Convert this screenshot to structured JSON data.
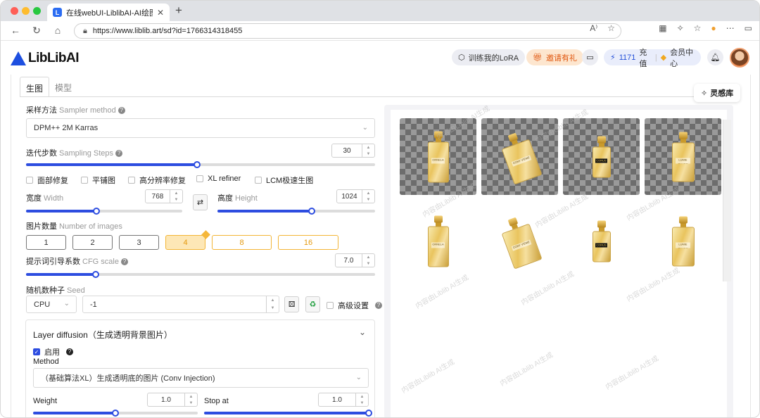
{
  "browser": {
    "tab_title": "在线webUI-LiblibAI-AI绘图工具",
    "tab_favicon": "L",
    "close": "✕",
    "new_tab": "+",
    "url": "https://www.liblib.art/sd?id=1766314318455",
    "nav": {
      "back": "←",
      "reload": "↻",
      "home": "⌂"
    },
    "right_icons": [
      "A⁾",
      "☆",
      "▦",
      "✧",
      "☆",
      "●",
      "⋯",
      "▭"
    ]
  },
  "header": {
    "logo_text": "LibLibAI",
    "train_lora": "训练我的LoRA",
    "invite": "邀请有礼",
    "recharge_count": "1171",
    "recharge_label": "充值",
    "vip": "会员中心"
  },
  "tabs": [
    {
      "label": "生图"
    },
    {
      "label": "模型"
    }
  ],
  "inspiration": "灵感库",
  "sampler": {
    "label": "采样方法",
    "label_en": "Sampler method",
    "value": "DPM++ 2M Karras"
  },
  "steps": {
    "label": "迭代步数",
    "label_en": "Sampling Steps",
    "value": "30",
    "fraction": 0.49
  },
  "options": [
    {
      "label": "面部修复",
      "checked": false
    },
    {
      "label": "平铺图",
      "checked": false
    },
    {
      "label": "高分辨率修复",
      "checked": false
    },
    {
      "label": "XL refiner",
      "checked": false
    },
    {
      "label": "LCM极速生图",
      "checked": false
    }
  ],
  "width": {
    "label": "宽度",
    "label_en": "Width",
    "value": "768",
    "fraction": 0.45
  },
  "height": {
    "label": "高度",
    "label_en": "Height",
    "value": "1024",
    "fraction": 0.6
  },
  "swap_icon": "⇄",
  "image_count": {
    "label": "图片数量",
    "label_en": "Number of images",
    "options": [
      "1",
      "2",
      "3",
      "4",
      "8",
      "16"
    ],
    "selected": "4"
  },
  "cfg": {
    "label": "提示词引导系数",
    "label_en": "CFG scale",
    "value": "7.0",
    "fraction": 0.2
  },
  "seed": {
    "label": "随机数种子",
    "label_en": "Seed",
    "device": "CPU",
    "value": "-1",
    "advanced": "高级设置"
  },
  "layer_diffusion": {
    "title": "Layer diffusion（生成透明背景图片）",
    "enable_label": "启用",
    "enabled": true,
    "method_label": "Method",
    "method_value": "（基础算法XL）生成透明底的图片 (Conv Injection)",
    "weight_label": "Weight",
    "weight_value": "1.0",
    "weight_fraction": 0.5,
    "stop_label": "Stop at",
    "stop_value": "1.0",
    "stop_fraction": 1.0
  },
  "gallery": {
    "images": [
      {
        "label": "ORNELA",
        "bg": "checker"
      },
      {
        "label": "CONY VIEME",
        "bg": "checker"
      },
      {
        "label": "CORUS",
        "bg": "checker"
      },
      {
        "label": "LUMIE GAUDE",
        "bg": "checker"
      },
      {
        "label": "ORNELA",
        "bg": "white"
      },
      {
        "label": "CONY VIEME",
        "bg": "white"
      },
      {
        "label": "CORUS",
        "bg": "white"
      },
      {
        "label": "LUMIE GAUDE",
        "bg": "white"
      }
    ],
    "watermark": "内容由Liblib AI生成"
  }
}
